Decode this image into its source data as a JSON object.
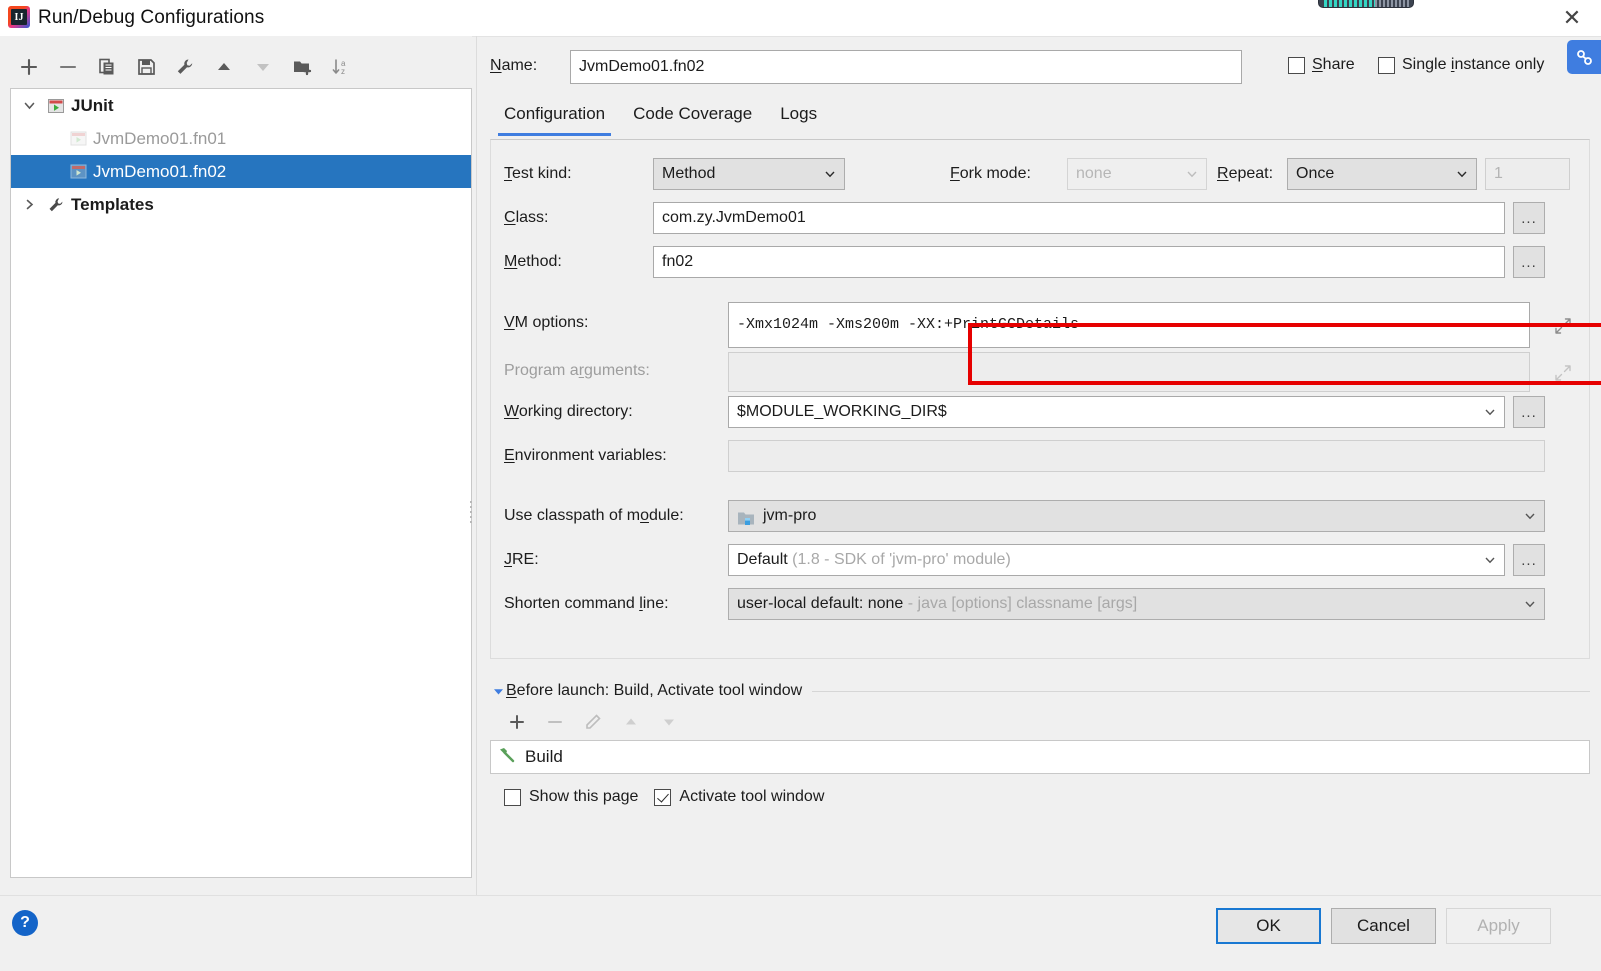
{
  "window": {
    "title": "Run/Debug Configurations",
    "close_label": "✕",
    "app_icon": "IJ"
  },
  "left_panel": {
    "toolbar": [
      {
        "name": "add-button",
        "icon": "plus-icon",
        "label": "+"
      },
      {
        "name": "remove-button",
        "icon": "minus-icon",
        "label": "−"
      },
      {
        "name": "copy-button",
        "icon": "copy-icon",
        "label": "Copy Configuration"
      },
      {
        "name": "save-button",
        "icon": "save-icon",
        "label": "Save Configuration"
      },
      {
        "name": "edit-templates-button",
        "icon": "wrench-icon",
        "label": "Edit Templates"
      },
      {
        "name": "move-up-button",
        "icon": "arrow-up-icon",
        "label": "Move Up"
      },
      {
        "name": "move-down-button",
        "icon": "arrow-down-icon",
        "label": "Move Down"
      },
      {
        "name": "new-folder-button",
        "icon": "folder-add-icon",
        "label": "Create New Folder"
      },
      {
        "name": "sort-button",
        "icon": "sort-az-icon",
        "label": "Sort Configurations"
      }
    ],
    "tree": [
      {
        "label": "JUnit",
        "level": 0,
        "expanded": true,
        "bold": true,
        "selected": false,
        "dim": false,
        "icon": "junit-icon"
      },
      {
        "label": "JvmDemo01.fn01",
        "level": 1,
        "expanded": null,
        "bold": false,
        "selected": false,
        "dim": true,
        "icon": "junit-run-icon"
      },
      {
        "label": "JvmDemo01.fn02",
        "level": 1,
        "expanded": null,
        "bold": false,
        "selected": true,
        "dim": false,
        "icon": "junit-run-icon"
      },
      {
        "label": "Templates",
        "level": 0,
        "expanded": false,
        "bold": true,
        "selected": false,
        "dim": false,
        "icon": "wrench-icon"
      }
    ]
  },
  "header": {
    "name_label": "Name:",
    "name_value": "JvmDemo01.fn02",
    "share_label": "Share",
    "share_checked": false,
    "single_instance_label": "Single instance only",
    "single_instance_checked": false
  },
  "tabs": [
    {
      "label": "Configuration",
      "active": true
    },
    {
      "label": "Code Coverage",
      "active": false
    },
    {
      "label": "Logs",
      "active": false
    }
  ],
  "configuration": {
    "test_kind_label": "Test kind:",
    "test_kind_value": "Method",
    "fork_mode_label": "Fork mode:",
    "fork_mode_value": "none",
    "fork_mode_disabled": true,
    "repeat_label": "Repeat:",
    "repeat_value": "Once",
    "repeat_count_value": "1",
    "repeat_count_disabled": true,
    "class_label": "Class:",
    "class_value": "com.zy.JvmDemo01",
    "method_label": "Method:",
    "method_value": "fn02",
    "vm_options_label": "VM options:",
    "vm_options_value": "-Xmx1024m -Xms200m -XX:+PrintGCDetails",
    "program_arguments_label": "Program arguments:",
    "program_arguments_value": "",
    "working_directory_label": "Working directory:",
    "working_directory_value": "$MODULE_WORKING_DIR$",
    "environment_variables_label": "Environment variables:",
    "environment_variables_value": "",
    "classpath_label": "Use classpath of module:",
    "classpath_value": "jvm-pro",
    "jre_label": "JRE:",
    "jre_value": "Default",
    "jre_hint": "(1.8 - SDK of 'jvm-pro' module)",
    "shorten_label": "Shorten command line:",
    "shorten_value": "user-local default: none",
    "shorten_hint": "- java [options] classname [args]",
    "browse_label": "...",
    "highlight_color": "#e60000"
  },
  "before_launch": {
    "header": "Before launch: Build, Activate tool window",
    "toolbar": [
      {
        "name": "bl-add-button",
        "icon": "plus-icon",
        "label": "+",
        "enabled": true
      },
      {
        "name": "bl-remove-button",
        "icon": "minus-icon",
        "label": "−",
        "enabled": false
      },
      {
        "name": "bl-edit-button",
        "icon": "pencil-icon",
        "label": "Edit",
        "enabled": false
      },
      {
        "name": "bl-up-button",
        "icon": "arrow-up-icon",
        "label": "Up",
        "enabled": false
      },
      {
        "name": "bl-down-button",
        "icon": "arrow-down-icon",
        "label": "Down",
        "enabled": false
      }
    ],
    "items": [
      {
        "label": "Build",
        "icon": "hammer-icon"
      }
    ],
    "show_page_label": "Show this page",
    "show_page_checked": false,
    "activate_tool_window_label": "Activate tool window",
    "activate_tool_window_checked": true
  },
  "footer": {
    "help_label": "?",
    "ok_label": "OK",
    "cancel_label": "Cancel",
    "apply_label": "Apply",
    "apply_enabled": false
  }
}
